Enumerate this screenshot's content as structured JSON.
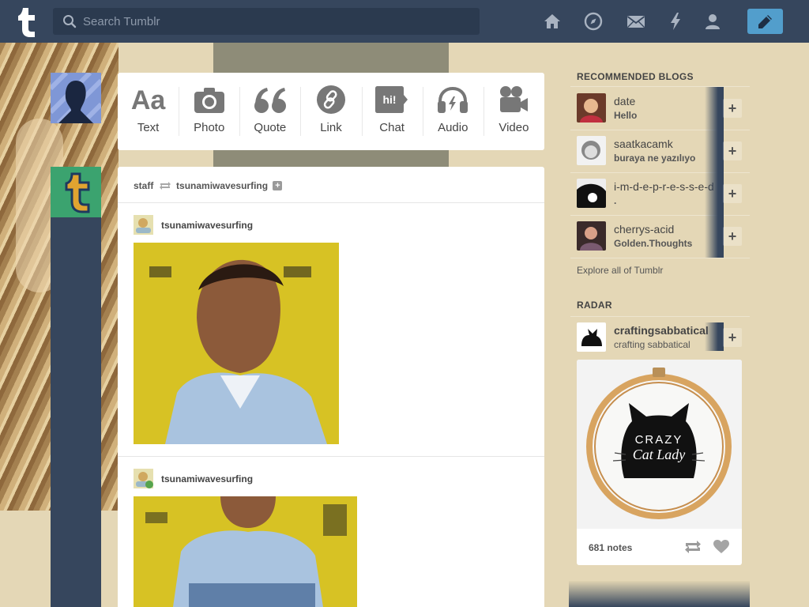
{
  "header": {
    "search_placeholder": "Search Tumblr",
    "nav_icons": [
      "home-icon",
      "explore-icon",
      "messages-icon",
      "activity-icon",
      "account-icon"
    ],
    "compose_icon": "pencil-icon",
    "colors": {
      "bar": "#36465d",
      "compose": "#529ecc"
    }
  },
  "composer": {
    "types": [
      {
        "label": "Text",
        "icon": "text-icon"
      },
      {
        "label": "Photo",
        "icon": "camera-icon"
      },
      {
        "label": "Quote",
        "icon": "quote-icon"
      },
      {
        "label": "Link",
        "icon": "link-icon"
      },
      {
        "label": "Chat",
        "icon": "chat-icon",
        "glyph": "hi!"
      },
      {
        "label": "Audio",
        "icon": "headphones-icon"
      },
      {
        "label": "Video",
        "icon": "video-camera-icon"
      }
    ]
  },
  "post": {
    "reblogger": "staff",
    "source": "tsunamiwavesurfing",
    "follow_symbol": "+",
    "entries": [
      {
        "username": "tsunamiwavesurfing"
      },
      {
        "username": "tsunamiwavesurfing"
      }
    ]
  },
  "sidebar": {
    "recommended_title": "RECOMMENDED BLOGS",
    "recommended": [
      {
        "name": "date",
        "subtitle": "Hello"
      },
      {
        "name": "saatkacamk",
        "subtitle": "buraya ne yazılıyo"
      },
      {
        "name": "i-m-d-e-p-r-e-s-s-e-d",
        "subtitle": "."
      },
      {
        "name": "cherrys-acid",
        "subtitle": "Golden.Thoughts"
      }
    ],
    "add_symbol": "+",
    "explore_link": "Explore all of Tumblr",
    "radar_title": "RADAR",
    "radar": {
      "name": "craftingsabbatical",
      "subtitle": "crafting sabbatical",
      "notes": "681 notes",
      "image_text_line1": "CRAZY",
      "image_text_line2": "Cat Lady"
    }
  }
}
